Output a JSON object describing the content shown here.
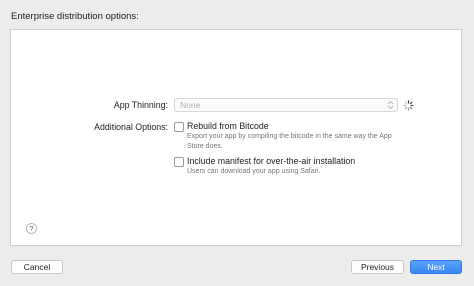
{
  "heading": "Enterprise distribution options:",
  "app_thinning": {
    "label": "App Thinning:",
    "value": "None"
  },
  "additional_options": {
    "label": "Additional Options:",
    "options": [
      {
        "label": "Rebuild from Bitcode",
        "description": "Export your app by compiling the bitcode in the same way the App Store does.",
        "checked": false
      },
      {
        "label": "Include manifest for over-the-air installation",
        "description": "Users can download your app using Safari.",
        "checked": false
      }
    ]
  },
  "help": "?",
  "buttons": {
    "cancel": "Cancel",
    "previous": "Previous",
    "next": "Next"
  },
  "colors": {
    "primary": "#3686f3",
    "background": "#ececec",
    "panel": "#ffffff"
  }
}
